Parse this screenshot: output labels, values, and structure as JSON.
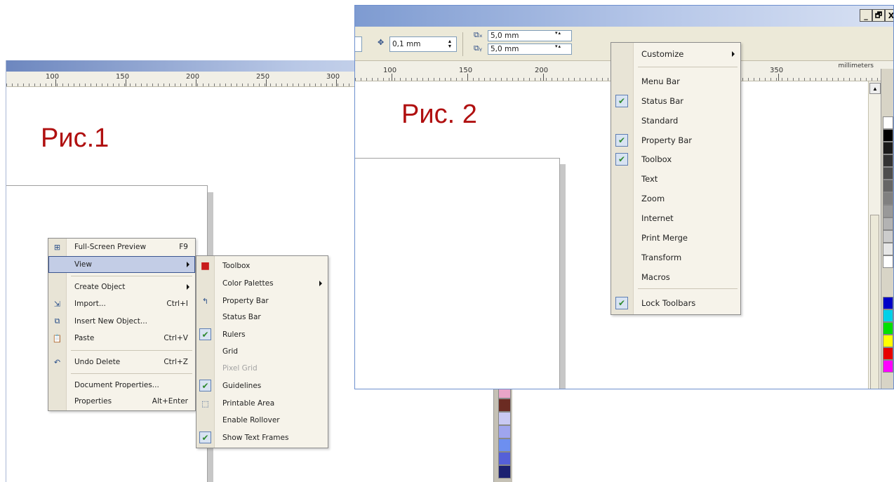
{
  "fig1": {
    "label": "Рис.1",
    "ruler_numbers": [
      "100",
      "150",
      "200",
      "250",
      "300"
    ],
    "context_menu": {
      "items": [
        {
          "label": "Full-Screen Preview",
          "shortcut": "F9",
          "icon": "full-screen-preview-icon"
        },
        {
          "label": "View",
          "submenu": true,
          "selected": true
        },
        {
          "label": "Create Object",
          "submenu": true
        },
        {
          "label": "Import...",
          "shortcut": "Ctrl+I",
          "icon": "import-icon"
        },
        {
          "label": "Insert New Object...",
          "icon": "insert-object-icon"
        },
        {
          "label": "Paste",
          "shortcut": "Ctrl+V",
          "icon": "paste-icon"
        },
        {
          "label": "Undo Delete",
          "shortcut": "Ctrl+Z",
          "icon": "undo-icon"
        },
        {
          "label": "Document Properties..."
        },
        {
          "label": "Properties",
          "shortcut": "Alt+Enter"
        }
      ]
    },
    "view_submenu": {
      "items": [
        {
          "label": "Toolbox",
          "icon": "toolbox-icon"
        },
        {
          "label": "Color Palettes",
          "submenu": true
        },
        {
          "label": "Property Bar",
          "icon": "property-bar-icon"
        },
        {
          "label": "Status Bar"
        },
        {
          "label": "Rulers",
          "checked": true
        },
        {
          "label": "Grid"
        },
        {
          "label": "Pixel Grid",
          "disabled": true
        },
        {
          "label": "Guidelines",
          "checked": true
        },
        {
          "label": "Printable Area",
          "icon": "printable-area-icon"
        },
        {
          "label": "Enable Rollover"
        },
        {
          "label": "Show Text Frames",
          "checked": true
        }
      ]
    },
    "palette_colors": [
      "#e9a5c8",
      "#6b2b22",
      "#c9c9f3",
      "#9fa5ee",
      "#6d8ff0",
      "#5560d8",
      "#3b3fb0",
      "#1c2170"
    ]
  },
  "fig2": {
    "label": "Рис. 2",
    "window_buttons": [
      "_",
      "🗗",
      "X"
    ],
    "property_bar": {
      "nudge_value": "0,1 mm",
      "dup_x": "5,0 mm",
      "dup_y": "5,0 mm"
    },
    "ruler_numbers": [
      "100",
      "150",
      "200",
      "350"
    ],
    "ruler_units": "millimeters",
    "toolbars_menu": {
      "items": [
        {
          "label": "Customize",
          "submenu": true
        },
        {
          "label": "Menu Bar"
        },
        {
          "label": "Status Bar",
          "checked": true
        },
        {
          "label": "Standard"
        },
        {
          "label": "Property Bar",
          "checked": true
        },
        {
          "label": "Toolbox",
          "checked": true
        },
        {
          "label": "Text"
        },
        {
          "label": "Zoom"
        },
        {
          "label": "Internet"
        },
        {
          "label": "Print Merge"
        },
        {
          "label": "Transform"
        },
        {
          "label": "Macros"
        },
        {
          "label": "Lock Toolbars",
          "checked": true
        }
      ]
    },
    "palette_colors": [
      "#ffffff",
      "#000000",
      "#1a1a1a",
      "#333333",
      "#4d4d4d",
      "#666666",
      "#808080",
      "#999999",
      "#b3b3b3",
      "#cccccc",
      "#e6e6e6",
      "#ffffff",
      "#0000c8",
      "#00d0e8",
      "#00e000",
      "#ffff00",
      "#e80000",
      "#ff00ff"
    ]
  }
}
